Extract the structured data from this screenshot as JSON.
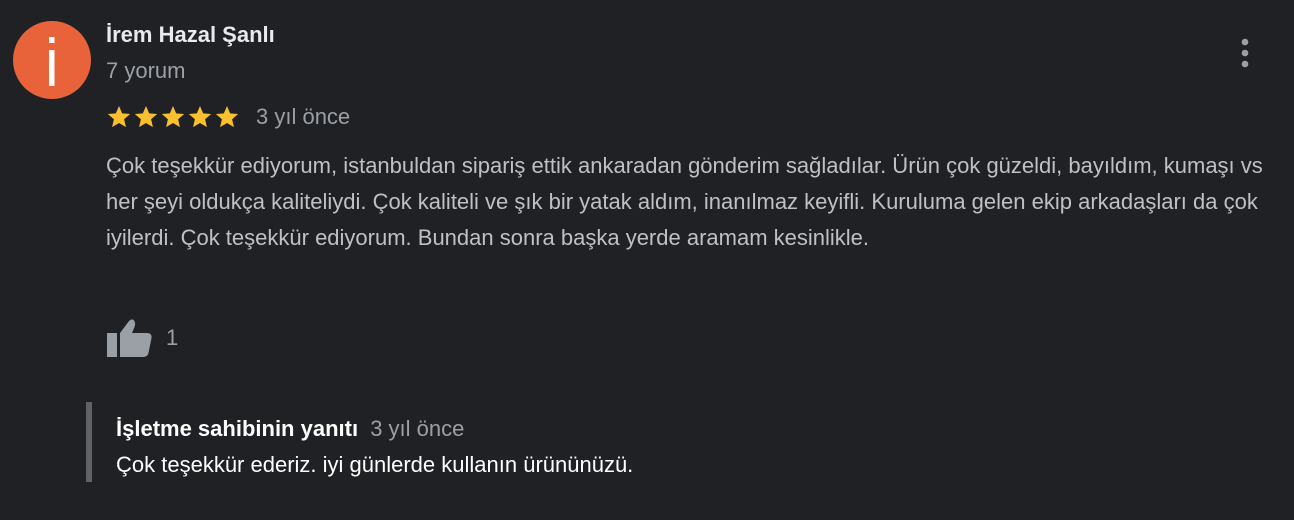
{
  "review": {
    "author": {
      "initial": "İ",
      "avatar_color": "#e8623a",
      "name": "İrem Hazal Şanlı",
      "meta": "7 yorum"
    },
    "more_icon": "more-vert-icon",
    "rating": {
      "stars": 5,
      "max": 5,
      "star_color": "#fbc02d",
      "time": "3 yıl önce"
    },
    "text": "Çok teşekkür ediyorum, istanbuldan sipariş ettik ankaradan gönderim sağladılar. Ürün çok güzeldi, bayıldım, kumaşı vs her şeyi oldukça kaliteliydi. Çok kaliteli ve şık bir yatak aldım, inanılmaz keyifli. Kuruluma gelen ekip arkadaşları da çok iyilerdi. Çok teşekkür ediyorum. Bundan sonra başka yerde aramam kesinlikle.",
    "like": {
      "icon": "thumbs-up-icon",
      "count": "1"
    },
    "owner_response": {
      "label": "İşletme sahibinin yanıtı",
      "time": "3 yıl önce",
      "text": "Çok teşekkür ederiz. iyi günlerde kullanın ürününüzü."
    }
  }
}
